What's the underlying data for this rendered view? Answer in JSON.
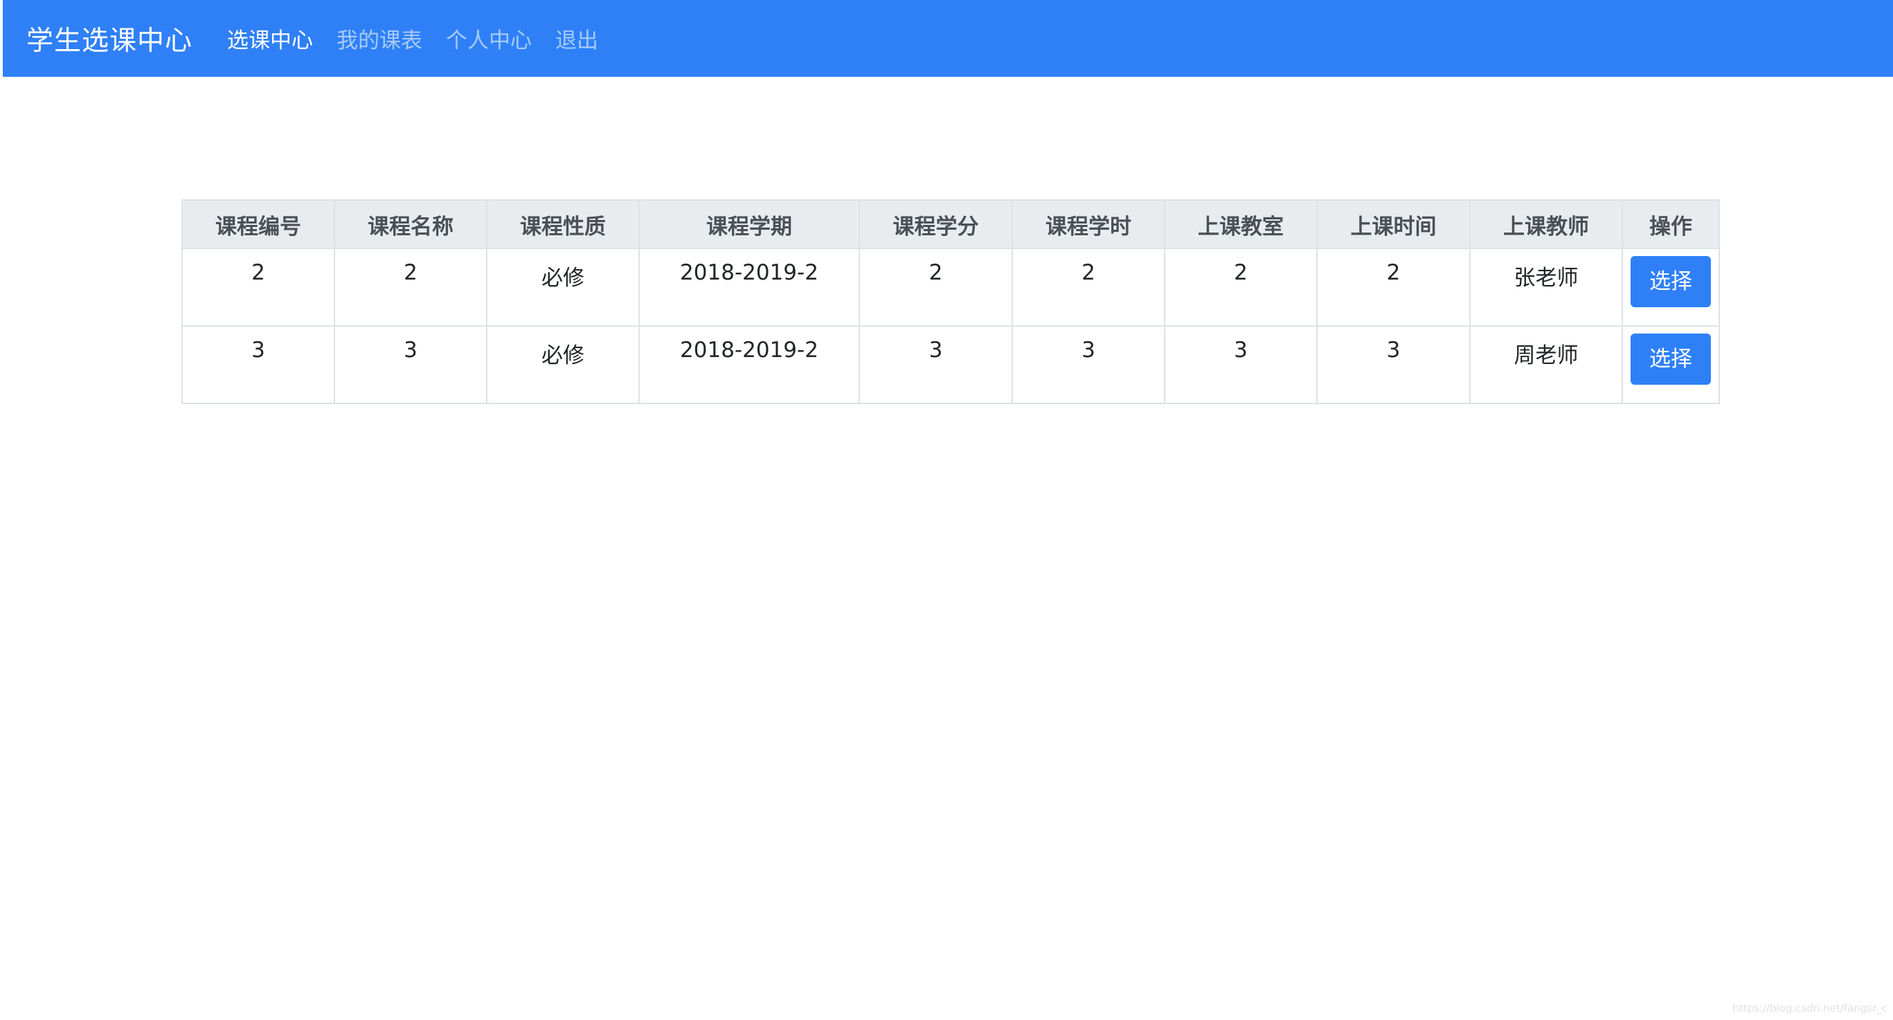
{
  "navbar": {
    "brand": "学生选课中心",
    "links": [
      {
        "label": "选课中心",
        "active": true
      },
      {
        "label": "我的课表",
        "active": false
      },
      {
        "label": "个人中心",
        "active": false
      },
      {
        "label": "退出",
        "active": false
      }
    ]
  },
  "table": {
    "columns": [
      "课程编号",
      "课程名称",
      "课程性质",
      "课程学期",
      "课程学分",
      "课程学时",
      "上课教室",
      "上课时间",
      "上课教师",
      "操作"
    ],
    "rows": [
      {
        "id": "2",
        "name": "2",
        "nature": "必修",
        "term": "2018-2019-2",
        "credit": "2",
        "hours": "2",
        "room": "2",
        "time": "2",
        "teacher": "张老师",
        "action": "选择"
      },
      {
        "id": "3",
        "name": "3",
        "nature": "必修",
        "term": "2018-2019-2",
        "credit": "3",
        "hours": "3",
        "room": "3",
        "time": "3",
        "teacher": "周老师",
        "action": "选择"
      }
    ]
  },
  "watermark": "https://blog.csdn.net/fangsr_c",
  "colors": {
    "navbar_bg": "#2f80f7",
    "button_bg": "#2f80f7",
    "header_bg": "#e9ecef"
  }
}
